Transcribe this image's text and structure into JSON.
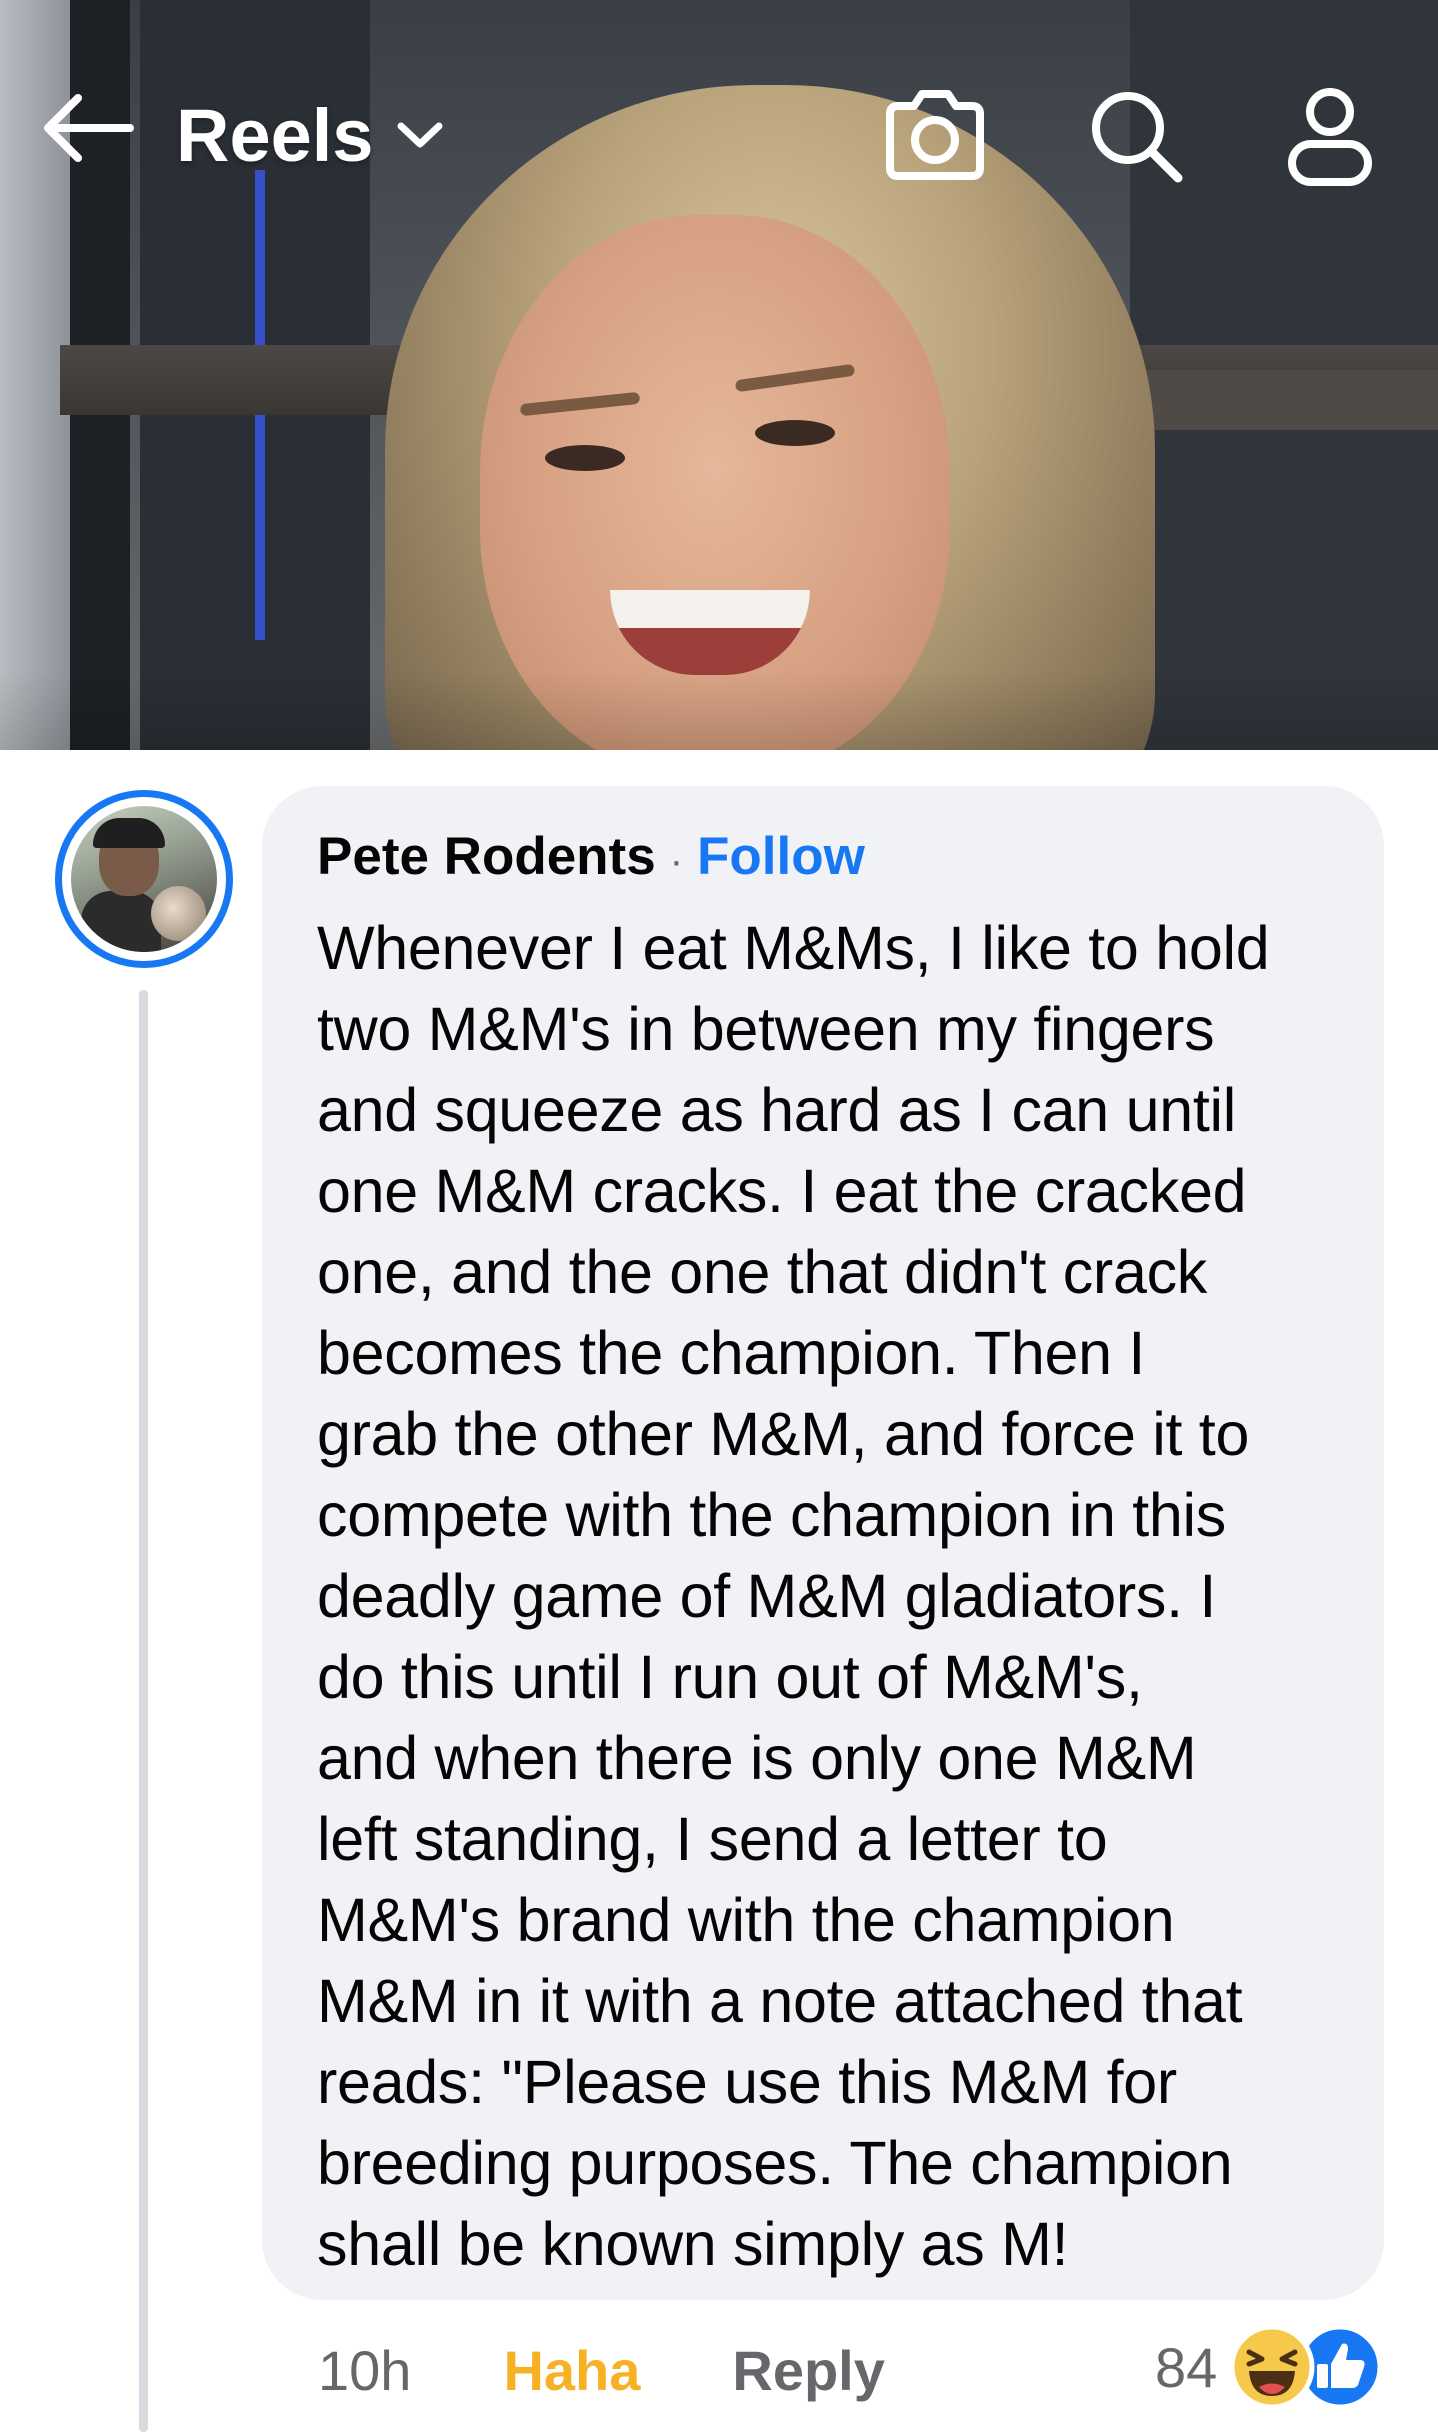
{
  "header": {
    "title": "Reels",
    "back_icon": "arrow-left-icon",
    "dropdown_icon": "chevron-down-icon",
    "camera_icon": "camera-icon",
    "search_icon": "search-icon",
    "profile_icon": "person-icon"
  },
  "comment": {
    "author": "Pete Rodents",
    "separator": "·",
    "follow_label": "Follow",
    "lines": [
      "Whenever I eat M&Ms, I like to hold",
      "two M&M's in between my fingers",
      "and squeeze as hard as I can until",
      "one M&M cracks. I eat the cracked",
      "one, and the one that didn't crack",
      "becomes the champion. Then I",
      "grab the other M&M, and force it to",
      "compete with the champion in this",
      "deadly game of M&M gladiators. I",
      "do this until I run out of M&M's,",
      "and when there is only one M&M",
      "left standing, I send a letter to",
      "M&M's brand with the champion",
      "M&M in it with a note attached that",
      "reads: \"Please use this M&M for",
      "breeding purposes. The champion",
      "shall be known simply as M!"
    ],
    "time": "10h",
    "reaction_label": "Haha",
    "reply_label": "Reply",
    "reaction_count": "84",
    "reaction_icons": [
      "haha-emoji-icon",
      "like-icon"
    ]
  },
  "colors": {
    "accent": "#1877f2",
    "haha": "#f7b125",
    "bubble": "#f0f2f5",
    "muted_text": "#65676b"
  }
}
